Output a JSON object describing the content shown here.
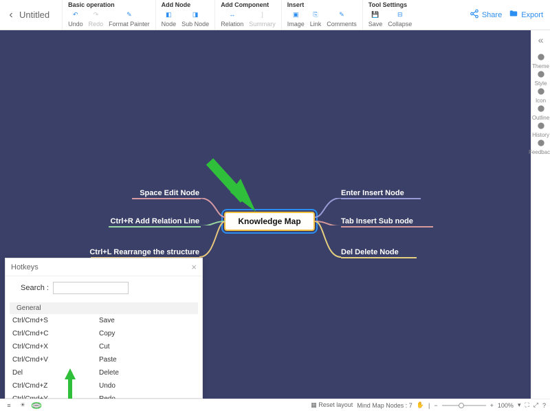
{
  "title": "Untitled",
  "toolbar": {
    "groups": [
      {
        "label": "Basic operation",
        "tools": [
          {
            "name": "Undo",
            "icon": "↶",
            "enabled": true
          },
          {
            "name": "Redo",
            "icon": "↷",
            "enabled": false
          },
          {
            "name": "Format Painter",
            "icon": "✎",
            "enabled": true
          }
        ]
      },
      {
        "label": "Add Node",
        "tools": [
          {
            "name": "Node",
            "icon": "◧",
            "enabled": true
          },
          {
            "name": "Sub Node",
            "icon": "◨",
            "enabled": true
          }
        ]
      },
      {
        "label": "Add Component",
        "tools": [
          {
            "name": "Relation",
            "icon": "↔",
            "enabled": true
          },
          {
            "name": "Summary",
            "icon": "]",
            "enabled": false
          }
        ]
      },
      {
        "label": "Insert",
        "tools": [
          {
            "name": "Image",
            "icon": "▣",
            "enabled": true
          },
          {
            "name": "Link",
            "icon": "⎘",
            "enabled": true
          },
          {
            "name": "Comments",
            "icon": "✎",
            "enabled": true
          }
        ]
      },
      {
        "label": "Tool Settings",
        "tools": [
          {
            "name": "Save",
            "icon": "💾",
            "enabled": true
          },
          {
            "name": "Collapse",
            "icon": "⊟",
            "enabled": true
          }
        ]
      }
    ],
    "share": "Share",
    "export": "Export"
  },
  "sidebar": {
    "items": [
      {
        "label": "Theme",
        "icon": "tshirt"
      },
      {
        "label": "Style",
        "icon": "palette"
      },
      {
        "label": "Icon",
        "icon": "smile"
      },
      {
        "label": "Outline",
        "icon": "list"
      },
      {
        "label": "History",
        "icon": "clock"
      },
      {
        "label": "Feedback",
        "icon": "wrench"
      }
    ]
  },
  "canvas": {
    "center": "Knowledge Map",
    "branches_left": [
      {
        "text": "Space Edit Node",
        "color": "#d79aa3"
      },
      {
        "text": "Ctrl+R Add Relation Line",
        "color": "#9ad7a3"
      },
      {
        "text": "Ctrl+L Rearrange the structure",
        "color": "#e6c77d"
      }
    ],
    "branches_right": [
      {
        "text": "Enter Insert Node",
        "color": "#9a9ad7"
      },
      {
        "text": "Tab Insert Sub node",
        "color": "#d79a9a"
      },
      {
        "text": "Del Delete Node",
        "color": "#e6d07d"
      }
    ]
  },
  "hotkeys": {
    "title": "Hotkeys",
    "search_label": "Search :",
    "category": "General",
    "rows": [
      {
        "k": "Ctrl/Cmd+S",
        "v": "Save"
      },
      {
        "k": "Ctrl/Cmd+C",
        "v": "Copy"
      },
      {
        "k": "Ctrl/Cmd+X",
        "v": "Cut"
      },
      {
        "k": "Ctrl/Cmd+V",
        "v": "Paste"
      },
      {
        "k": "Del",
        "v": "Delete"
      },
      {
        "k": "Ctrl/Cmd+Z",
        "v": "Undo"
      },
      {
        "k": "Ctrl/Cmd+Y",
        "v": "Redo"
      }
    ]
  },
  "statusbar": {
    "reset": "Reset layout",
    "nodes_label": "Mind Map Nodes :",
    "nodes_count": "7",
    "zoom": "100%"
  }
}
